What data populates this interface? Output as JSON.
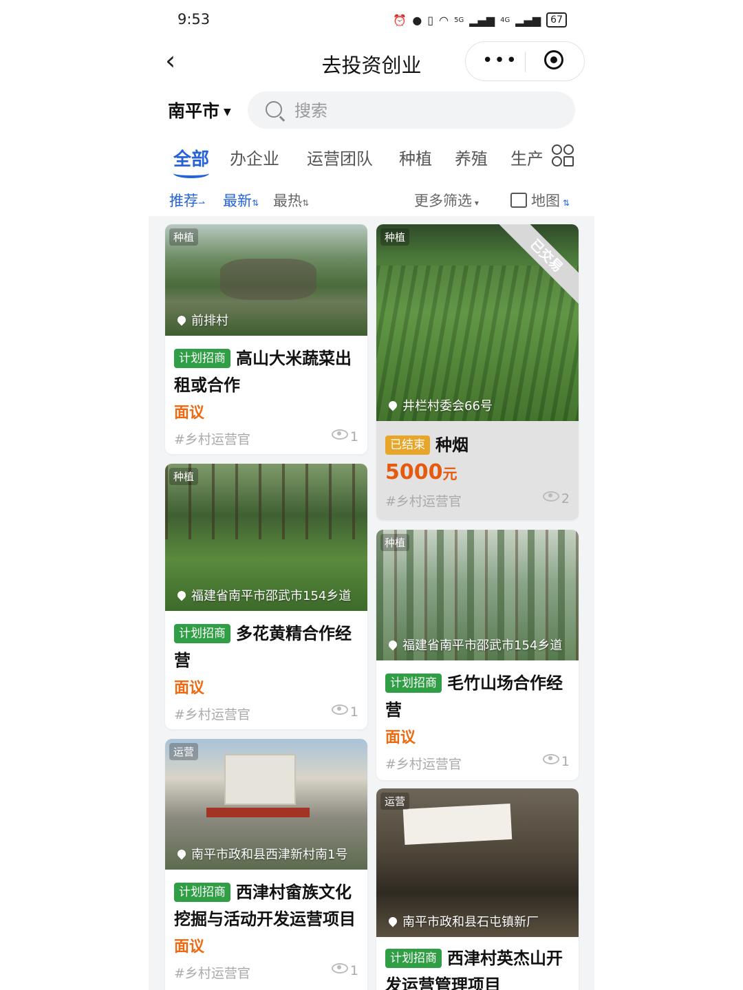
{
  "status_bar": {
    "time": "9:53",
    "network_5g": "5G",
    "network_4g": "4G",
    "battery": "67"
  },
  "nav": {
    "title": "去投资创业",
    "more": "•••"
  },
  "city": "南平市",
  "search": {
    "placeholder": "搜索"
  },
  "tabs": [
    "全部",
    "办企业",
    "运营团队",
    "种植",
    "养殖",
    "生产"
  ],
  "active_tab": "全部",
  "sorts": {
    "recommend": "推荐",
    "latest": "最新",
    "hot": "最热",
    "more_filters": "更多筛选",
    "map": "地图"
  },
  "colors": {
    "accent": "#2563d9",
    "badge_green": "#2f9e44",
    "badge_ended": "#e7a52a",
    "price": "#ee6a10"
  },
  "cards": [
    {
      "category": "种植",
      "location": "前排村",
      "badge": "计划招商",
      "title": "高山大米蔬菜出租或合作",
      "price": "面议",
      "tag": "#乡村运营官",
      "views": "1",
      "image": "mountain-village-photo"
    },
    {
      "category": "种植",
      "location": "井栏村委会66号",
      "ribbon": "已交易",
      "badge": "已结束",
      "title": "种烟",
      "price_value": "5000",
      "price_unit": "元",
      "tag": "#乡村运营官",
      "views": "2",
      "image": "tobacco-field-photo"
    },
    {
      "category": "种植",
      "location": "福建省南平市邵武市154乡道",
      "badge": "计划招商",
      "title": "多花黄精合作经营",
      "price": "面议",
      "tag": "#乡村运营官",
      "views": "1",
      "image": "forest-understory-photo"
    },
    {
      "category": "种植",
      "location": "福建省南平市邵武市154乡道",
      "badge": "计划招商",
      "title": "毛竹山场合作经营",
      "price": "面议",
      "tag": "#乡村运营官",
      "views": "1",
      "image": "bamboo-forest-photo"
    },
    {
      "category": "运营",
      "location": "南平市政和县西津新村南1号",
      "badge": "计划招商",
      "title": "西津村畲族文化挖掘与活动开发运营项目",
      "price": "面议",
      "tag": "#乡村运营官",
      "views": "1",
      "image": "village-square-photo"
    },
    {
      "category": "运营",
      "location": "南平市政和县石屯镇新厂",
      "badge": "计划招商",
      "title": "西津村英杰山开发运营管理项目",
      "image": "cave-sign-photo"
    }
  ]
}
